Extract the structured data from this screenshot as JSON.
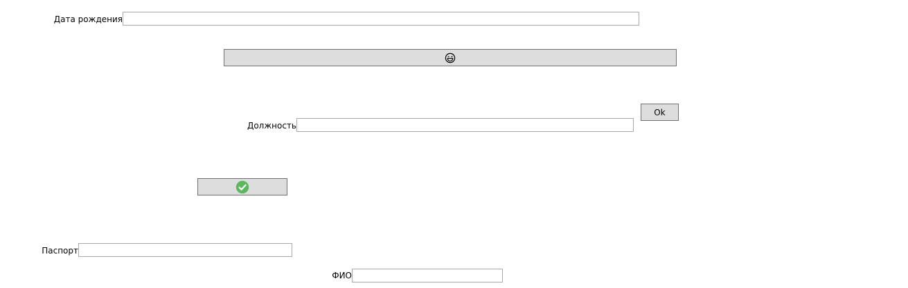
{
  "birthdate": {
    "label": "Дата рождения",
    "value": ""
  },
  "emoji_button": {
    "icon": "laughing-face-icon"
  },
  "ok_button": {
    "label": "Ok"
  },
  "position": {
    "label": "Должность",
    "value": ""
  },
  "check_button": {
    "icon": "green-check-icon",
    "color": "#5cb85c"
  },
  "passport": {
    "label": "Паспорт",
    "value": ""
  },
  "fio": {
    "label": "ФИО",
    "value": ""
  }
}
